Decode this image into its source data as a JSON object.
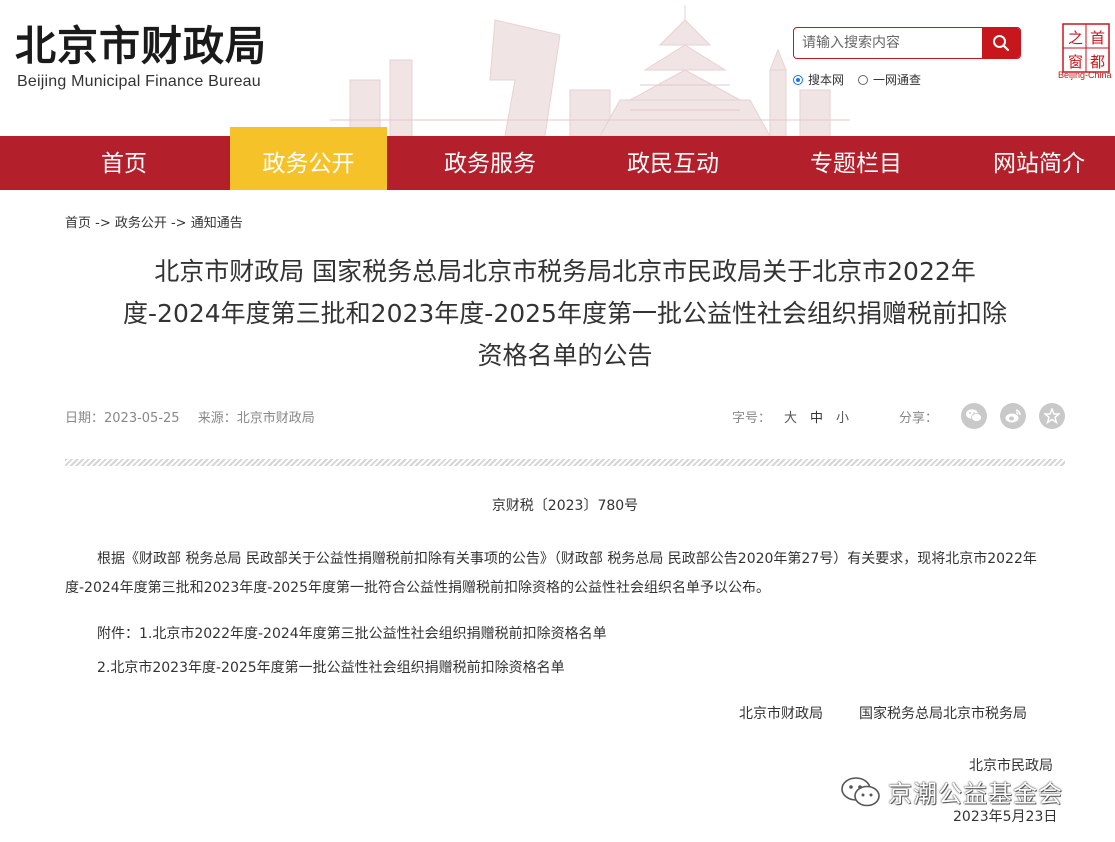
{
  "header": {
    "title": "北京市财政局",
    "subtitle": "Beijing Municipal Finance Bureau",
    "logo_text": "Beijing-China",
    "logo_chars": [
      "首",
      "都",
      "之",
      "窗"
    ]
  },
  "search": {
    "placeholder": "请输入搜索内容",
    "scopes": [
      {
        "label": "搜本网",
        "selected": true
      },
      {
        "label": "一网通查",
        "selected": false
      }
    ]
  },
  "nav": {
    "items": [
      {
        "label": "首页",
        "active": false
      },
      {
        "label": "政务公开",
        "active": true
      },
      {
        "label": "政务服务",
        "active": false
      },
      {
        "label": "政民互动",
        "active": false
      },
      {
        "label": "专题栏目",
        "active": false
      },
      {
        "label": "网站简介",
        "active": false
      }
    ]
  },
  "breadcrumb": "首页 -> 政务公开 -> 通知通告",
  "article": {
    "title_line1": "北京市财政局 国家税务总局北京市税务局北京市民政局关于北京市2022年",
    "title_line2": "度-2024年度第三批和2023年度-2025年度第一批公益性社会组织捐赠税前扣除",
    "title_line3": "资格名单的公告",
    "date": "日期：2023-05-25",
    "source": "来源：北京市财政局",
    "font_size_label": "字号：",
    "font_sizes": [
      "大",
      "中",
      "小"
    ],
    "share_label": "分享：",
    "doc_number": "京财税〔2023〕780号",
    "body": "根据《财政部 税务总局 民政部关于公益性捐赠税前扣除有关事项的公告》（财政部 税务总局 民政部公告2020年第27号）有关要求，现将北京市2022年度-2024年度第三批和2023年度-2025年度第一批符合公益性捐赠税前扣除资格的公益性社会组织名单予以公布。",
    "attachment1": "附件：1.北京市2022年度-2024年度第三批公益性社会组织捐赠税前扣除资格名单",
    "attachment2": "2.北京市2023年度-2025年度第一批公益性社会组织捐赠税前扣除资格名单",
    "signers": [
      "北京市财政局",
      "国家税务总局北京市税务局"
    ],
    "signer3": "北京市民政局",
    "sign_date": "2023年5月23日"
  },
  "watermark": "京潮公益基金会",
  "colors": {
    "brand_red": "#b31f2a",
    "active_tab": "#f6c22a",
    "search_red": "#c8161d"
  },
  "icons": [
    "search-icon",
    "wechat-icon",
    "weibo-icon",
    "favorite-icon"
  ]
}
